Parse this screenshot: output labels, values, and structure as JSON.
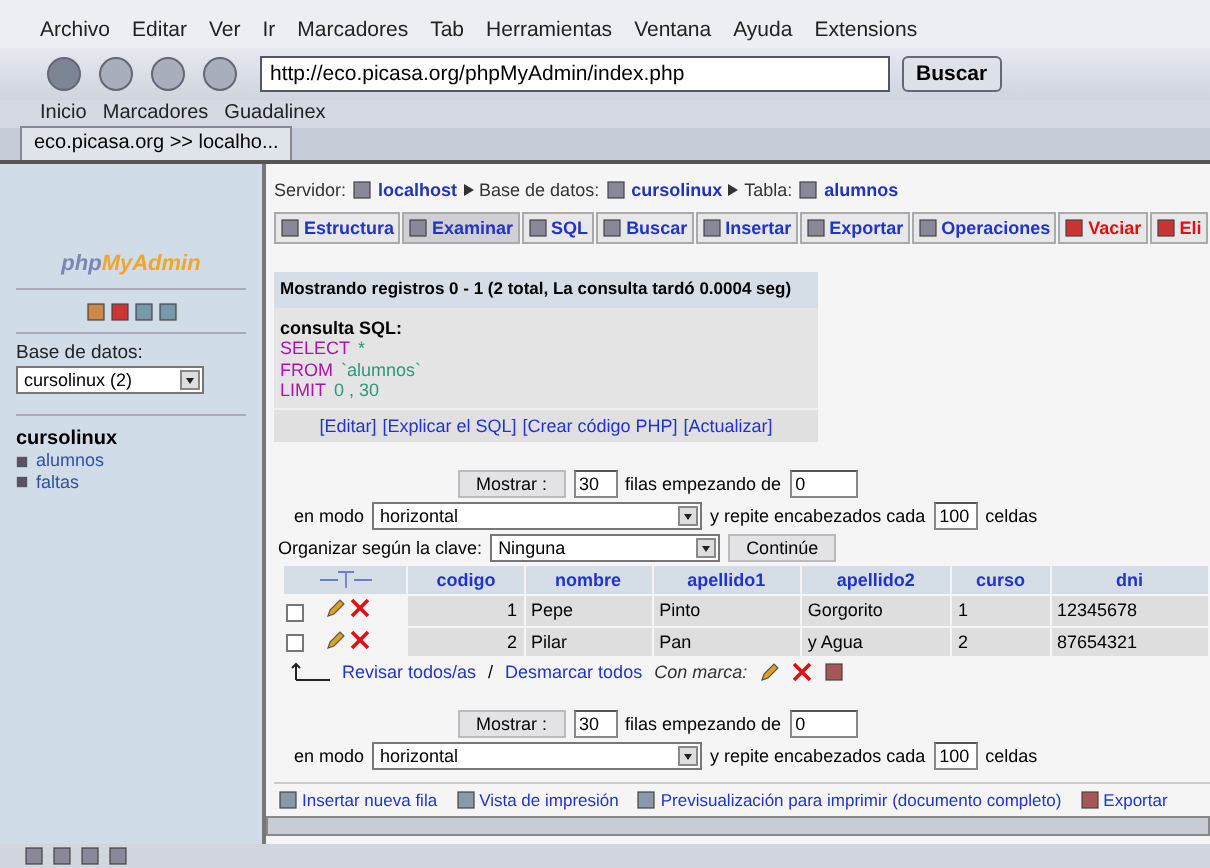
{
  "menu": [
    "Archivo",
    "Editar",
    "Ver",
    "Ir",
    "Marcadores",
    "Tab",
    "Herramientas",
    "Ventana",
    "Ayuda",
    "Extensions"
  ],
  "toolbar": {
    "url": "http://eco.picasa.org/phpMyAdmin/index.php",
    "search_button": "Buscar"
  },
  "bookmarks": [
    "Inicio",
    "Marcadores",
    "Guadalinex"
  ],
  "browser_tab": {
    "label": "eco.picasa.org >> localho..."
  },
  "sidebar": {
    "logo": [
      "php",
      "MyAdmin"
    ],
    "db_label": "Base de datos:",
    "db_select": "cursolinux (2)",
    "db_name": "cursolinux",
    "tables": [
      "alumnos",
      "faltas"
    ]
  },
  "breadcrumb": {
    "server_label": "Servidor:",
    "server": "localhost",
    "db_label": "Base de datos:",
    "db": "cursolinux",
    "table_label": "Tabla:",
    "table": "alumnos"
  },
  "tabs": [
    {
      "label": "Estructura",
      "selected": false,
      "kind": "normal"
    },
    {
      "label": "Examinar",
      "selected": true,
      "kind": "normal"
    },
    {
      "label": "SQL",
      "selected": false,
      "kind": "normal"
    },
    {
      "label": "Buscar",
      "selected": false,
      "kind": "normal"
    },
    {
      "label": "Insertar",
      "selected": false,
      "kind": "normal"
    },
    {
      "label": "Exportar",
      "selected": false,
      "kind": "normal"
    },
    {
      "label": "Operaciones",
      "selected": false,
      "kind": "normal"
    },
    {
      "label": "Vaciar",
      "selected": false,
      "kind": "danger"
    },
    {
      "label": "Eli",
      "selected": false,
      "kind": "danger"
    }
  ],
  "notice": "Mostrando registros 0 - 1 (2 total, La consulta tardó 0.0004 seg)",
  "sql": {
    "title": "consulta SQL:",
    "lines": [
      {
        "keyword": "SELECT",
        "rest": "*"
      },
      {
        "keyword": "FROM",
        "rest": "`alumnos`"
      },
      {
        "keyword": "LIMIT",
        "rest": "0 , 30"
      }
    ],
    "links": [
      "[Editar]",
      "[Explicar el SQL]",
      "[Crear código PHP]",
      "[Actualizar]"
    ]
  },
  "nav_forms": [
    {
      "show_button": "Mostrar :",
      "rows": "30",
      "from_label": "filas empezando de",
      "start": "0",
      "mode_label": "en modo",
      "mode": "horizontal",
      "repeat_label": "y repite encabezados cada",
      "repeat": "100",
      "cells_label": "celdas"
    },
    {
      "show_button": "Mostrar :",
      "rows": "30",
      "from_label": "filas empezando de",
      "start": "0",
      "mode_label": "en modo",
      "mode": "horizontal",
      "repeat_label": "y repite encabezados cada",
      "repeat": "100",
      "cells_label": "celdas"
    }
  ],
  "sort": {
    "label": "Organizar según la clave:",
    "value": "Ninguna",
    "button": "Continúe"
  },
  "table": {
    "columns": [
      "codigo",
      "nombre",
      "apellido1",
      "apellido2",
      "curso",
      "dni"
    ],
    "rows": [
      {
        "checked": false,
        "cells": [
          "1",
          "Pepe",
          "Pinto",
          "Gorgorito",
          "1",
          "12345678"
        ]
      },
      {
        "checked": false,
        "cells": [
          "2",
          "Pilar",
          "Pan",
          "y Agua",
          "2",
          "87654321"
        ]
      }
    ]
  },
  "selection": {
    "check_all": "Revisar todos/as",
    "separator": "/",
    "uncheck_all": "Desmarcar todos",
    "with_selected": "Con marca:"
  },
  "bottom_links": [
    "Insertar nueva fila",
    "Vista de impresión",
    "Previsualización para imprimir (documento completo)",
    "Exportar"
  ]
}
